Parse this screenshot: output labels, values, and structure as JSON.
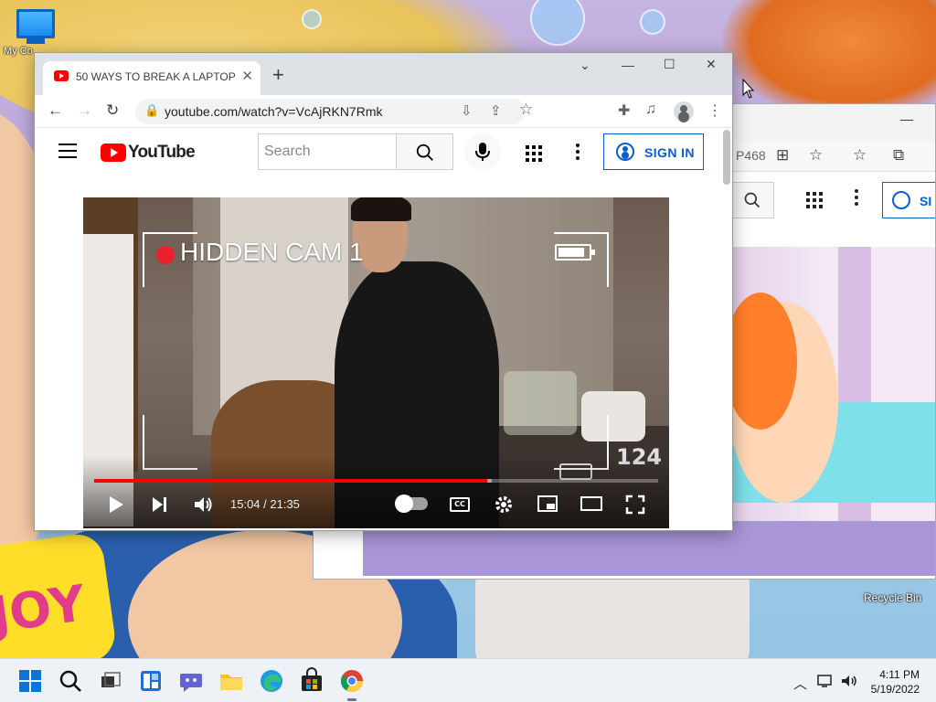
{
  "desktop": {
    "icon_label": "My Co",
    "recycle_bin": "Recycle Bin",
    "wallpaper_logo_text": "JOY"
  },
  "browser": {
    "tab_title": "50 WAYS TO BREAK A LAPTOP -",
    "url": "youtube.com/watch?v=VcAjRKN7Rmk",
    "window_controls": [
      "chevron-down",
      "minimize",
      "maximize",
      "close"
    ]
  },
  "youtube": {
    "logo_text": "YouTube",
    "search_placeholder": "Search",
    "sign_in": "SIGN IN"
  },
  "video": {
    "overlay_title": "HIDDEN CAM 1",
    "overlay_counter": "124",
    "current_time": "15:04",
    "duration": "21:35",
    "timecode": "15:04 / 21:35",
    "progress": 0.6975,
    "buffered": 0.69
  },
  "background_window": {
    "address_tail": "P468",
    "sign_in_partial": "SI"
  },
  "taskbar": {
    "apps": [
      "start",
      "search",
      "task-view",
      "widgets",
      "chat",
      "file-explorer",
      "edge",
      "store",
      "chrome"
    ],
    "time": "4:11 PM",
    "date": "5/19/2022"
  },
  "colors": {
    "youtube_red": "#ff0000",
    "signin_blue": "#065fd4",
    "recording_red": "#e8212b"
  }
}
